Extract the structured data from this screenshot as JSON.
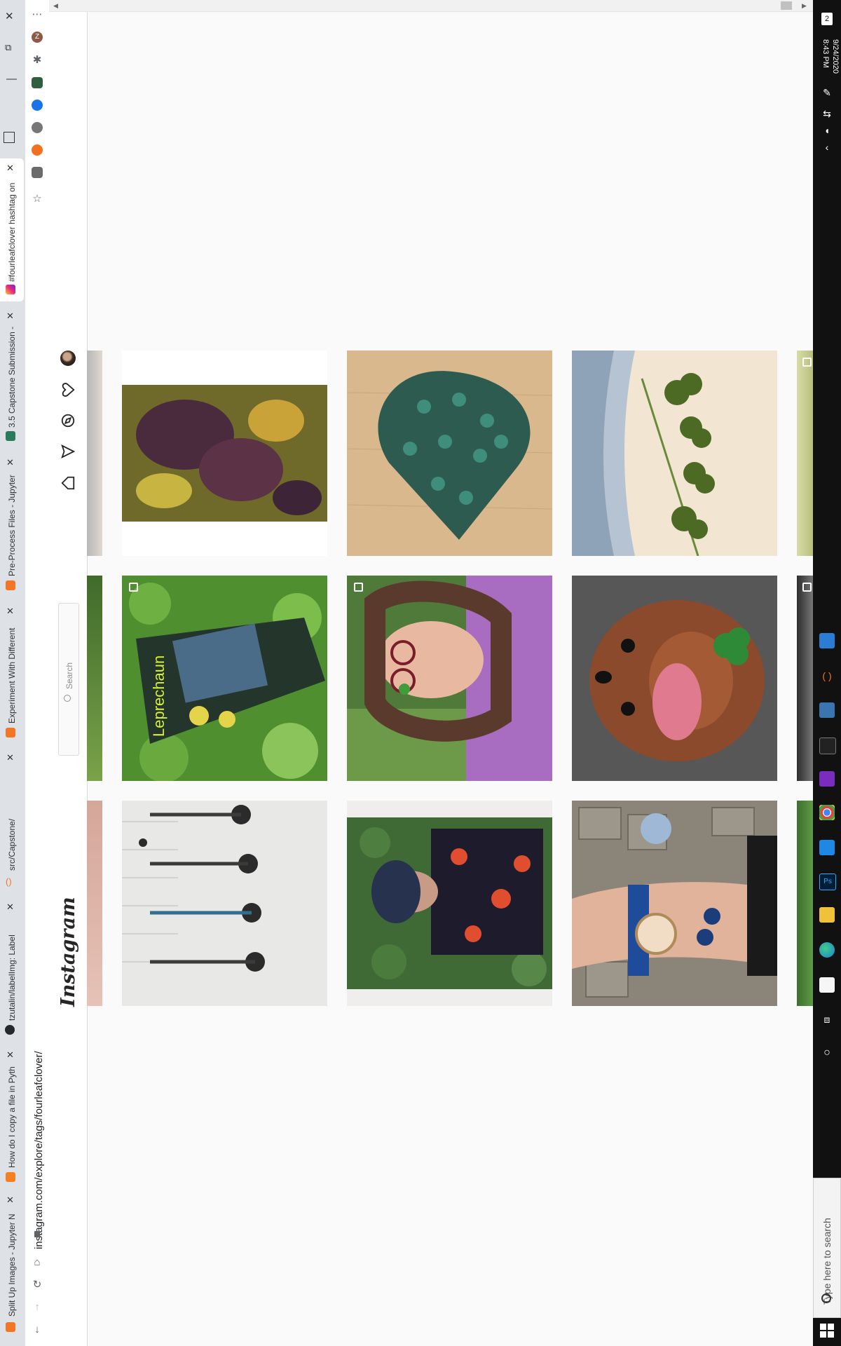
{
  "browser": {
    "tabs": [
      {
        "title": "#fourleafclover hashtag on",
        "active": true
      },
      {
        "title": "3.5 Capstone Submission -"
      },
      {
        "title": "Pre-Process Files - Jupyter"
      },
      {
        "title": "Experiment With Different"
      },
      {
        "title": "src/Capstone/"
      },
      {
        "title": "tzutalin/labelImg: Label"
      },
      {
        "title": "How do I copy a file in Pyth"
      },
      {
        "title": "Split Up Images - Jupyter N"
      }
    ],
    "address_bar": "instagram.com/explore/tags/fourleafclover/",
    "menu_icon": "ellipsis-icon",
    "extension_avatar_letter": "Z"
  },
  "instagram": {
    "logo_text": "Instagram",
    "search_placeholder": "Search",
    "nav_icons": [
      "home-icon",
      "direct-icon",
      "explore-icon",
      "heart-icon",
      "profile-avatar"
    ]
  },
  "grid": {
    "rows": [
      [
        {
          "subject": "purple and yellow clover leaves close-up"
        },
        {
          "subject": "heart shape made of clovers on wood"
        },
        {
          "subject": "clovers pressed on watercolor paper"
        }
      ],
      [
        {
          "subject": "leprechaun box in clover patch",
          "multi": true
        },
        {
          "subject": "woman holding four leaf clover",
          "multi": true
        },
        {
          "subject": "dog with clover"
        }
      ],
      [
        {
          "subject": "scooters on stairs"
        },
        {
          "subject": "woman in floral dress"
        },
        {
          "subject": "hand with bracelet and watch"
        }
      ]
    ]
  },
  "taskbar": {
    "time": "8:43 PM",
    "date": "9/24/2020",
    "search_placeholder": "Type here to search",
    "notification_count": "2"
  },
  "colors": {
    "chrome_tabstrip": "#dee1e6",
    "instagram_bg": "#fafafa",
    "taskbar": "#111111"
  }
}
